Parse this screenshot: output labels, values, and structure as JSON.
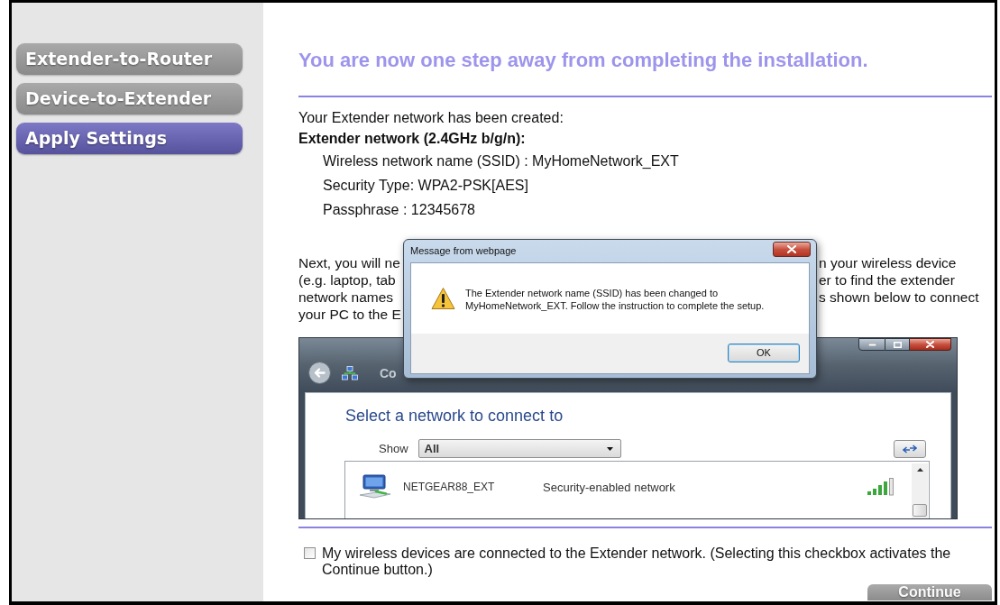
{
  "sidebar": {
    "items": [
      {
        "label": "Extender-to-Router",
        "selected": false
      },
      {
        "label": "Device-to-Extender",
        "selected": false
      },
      {
        "label": "Apply Settings",
        "selected": true
      }
    ]
  },
  "content": {
    "heading": "You are now one step away from completing the installation.",
    "intro": "Your Extender network has been created:",
    "network_heading": "Extender network (2.4GHz b/g/n):",
    "details": [
      "Wireless network name (SSID) : MyHomeNetwork_EXT",
      "Security Type: WPA2-PSK[AES]",
      "Passphrase : 12345678"
    ],
    "instructions": [
      {
        "left": "Next, you will ne",
        "right": "n your wireless device"
      },
      {
        "left": "(e.g. laptop, tab",
        "right": "er to find the extender"
      },
      {
        "left": "network names",
        "right": "s shown below to connect"
      },
      {
        "left": "your PC to the E"
      }
    ],
    "example_screenshot": {
      "window_title": "Co",
      "heading": "Select a network to connect to",
      "show_label": "Show",
      "show_value": "All",
      "networks": [
        {
          "name": "NETGEAR88_EXT",
          "status": "Security-enabled network"
        }
      ]
    },
    "confirm": {
      "label": "My wireless devices are connected to the Extender network. (Selecting this checkbox activates the Continue button.)",
      "checked": false
    },
    "continue_button": {
      "label": "Continue",
      "disabled": true
    }
  },
  "dialog": {
    "title": "Message from webpage",
    "message_lines": [
      "The Extender network name (SSID) has been changed to",
      "MyHomeNetwork_EXT. Follow the instruction to complete the setup."
    ],
    "button": "OK"
  }
}
